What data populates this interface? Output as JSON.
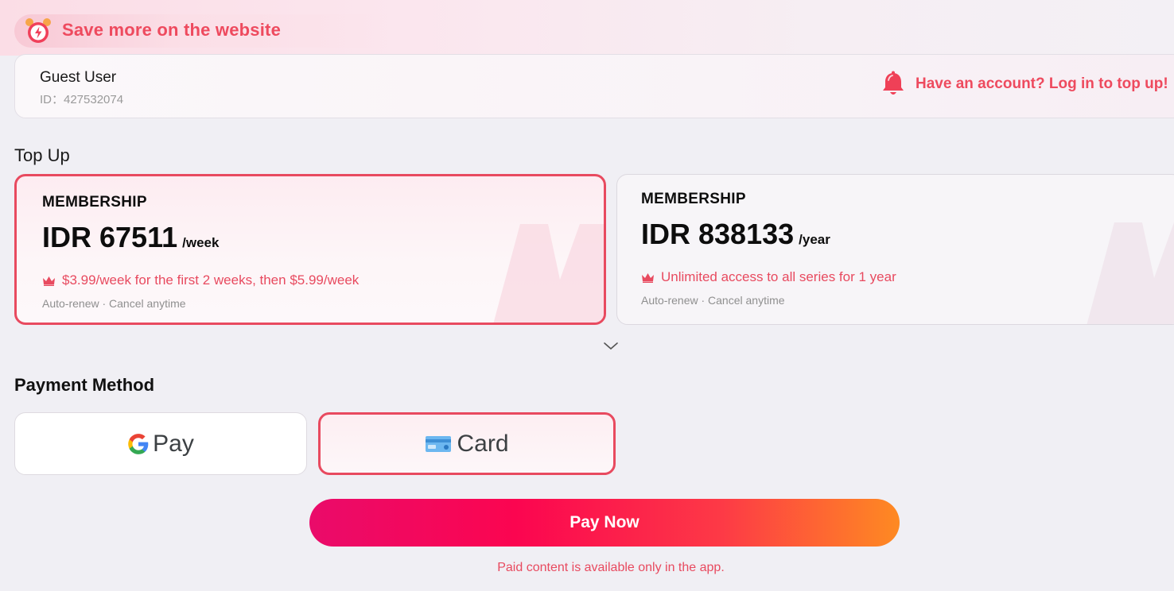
{
  "promo": {
    "text": "Save more on the website",
    "icon": "alarm-clock-icon"
  },
  "user": {
    "name": "Guest User",
    "id_text": "ID：427532074",
    "login_prompt": "Have an account? Log in to top up!",
    "login_icon": "bell-icon"
  },
  "topup": {
    "title": "Top Up",
    "plans": [
      {
        "label": "MEMBERSHIP",
        "price": "IDR 67511",
        "period": "/week",
        "benefit": "$3.99/week for the first 2 weeks, then $5.99/week",
        "renew": "Auto-renew · Cancel anytime",
        "selected": true
      },
      {
        "label": "MEMBERSHIP",
        "price": "IDR 838133",
        "period": "/year",
        "benefit": "Unlimited access to all series for 1 year",
        "renew": "Auto-renew · Cancel anytime",
        "selected": false
      }
    ]
  },
  "payment": {
    "title": "Payment Method",
    "options": [
      {
        "label": "Pay",
        "icon": "google-g-icon",
        "selected": false
      },
      {
        "label": "Card",
        "icon": "credit-card-icon",
        "selected": true
      }
    ]
  },
  "pay_now": {
    "label": "Pay Now"
  },
  "footnote": "Paid content is available only in the app.",
  "colors": {
    "accent": "#e84a5f",
    "background": "#f0eff4",
    "button_gradient": [
      "#ea0b6a",
      "#fb0550",
      "#fd3a46",
      "#fe8a22"
    ]
  }
}
